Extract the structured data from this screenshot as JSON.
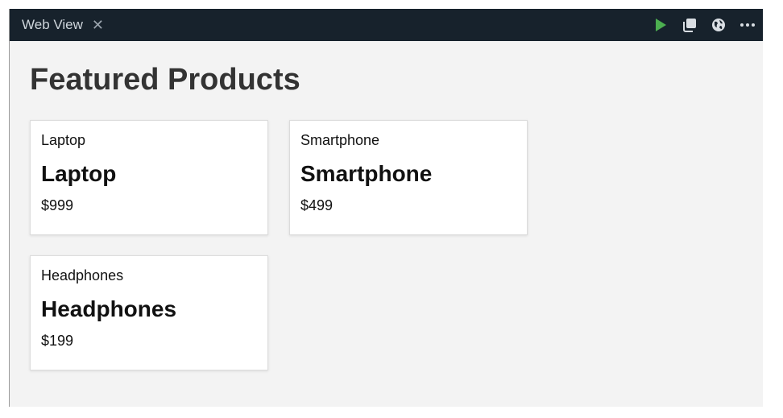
{
  "tab": {
    "title": "Web View",
    "close_glyph": "✕"
  },
  "toolbar": {
    "icons": [
      "run-icon",
      "copy-icon",
      "globe-icon",
      "more-icon"
    ],
    "run_color": "#4caf50"
  },
  "page": {
    "title": "Featured Products"
  },
  "products": [
    {
      "image_alt": "Laptop",
      "name": "Laptop",
      "price": "$999"
    },
    {
      "image_alt": "Smartphone",
      "name": "Smartphone",
      "price": "$499"
    },
    {
      "image_alt": "Headphones",
      "name": "Headphones",
      "price": "$199"
    }
  ]
}
